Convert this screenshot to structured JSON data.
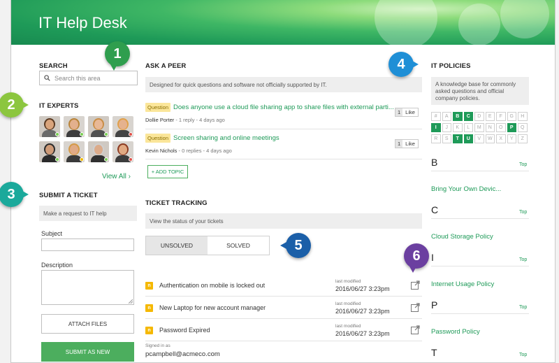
{
  "header": {
    "title": "IT Help Desk"
  },
  "search": {
    "heading": "SEARCH",
    "placeholder": "Search this area"
  },
  "experts": {
    "heading": "IT EXPERTS",
    "view_all": "View All ›",
    "people": [
      {
        "skin": "#d9a47c",
        "hair": "#5a3a22",
        "shirt": "#6a6a6a",
        "status": "#7ccf55"
      },
      {
        "skin": "#e3b08d",
        "hair": "#b8843a",
        "shirt": "#3d3d3d",
        "status": "#7ccf55"
      },
      {
        "skin": "#e8b896",
        "hair": "#c98d45",
        "shirt": "#505050",
        "status": "#7ccf55"
      },
      {
        "skin": "#e5b28e",
        "hair": "#e0a04a",
        "shirt": "#444",
        "status": "#e0524a"
      },
      {
        "skin": "#cf9b78",
        "hair": "#2c2c2c",
        "shirt": "#2a2a2a",
        "status": "#7ccf55"
      },
      {
        "skin": "#e0aa86",
        "hair": "#d49a48",
        "shirt": "#3a3a3a",
        "status": "#f0b900"
      },
      {
        "skin": "#dcab8a",
        "hair": "#cfcfcf",
        "shirt": "#303030",
        "status": "#7ccf55"
      },
      {
        "skin": "#e1a982",
        "hair": "#8c3b22",
        "shirt": "#3c3c3c",
        "status": "#e0524a"
      }
    ]
  },
  "ticket_form": {
    "heading": "SUBMIT A TICKET",
    "hint": "Make a request to IT help",
    "subject_label": "Subject",
    "description_label": "Description",
    "attach_label": "ATTACH FILES",
    "submit_label": "SUBMIT AS NEW"
  },
  "peer": {
    "heading": "ASK A PEER",
    "hint": "Designed for quick questions and software not officially supported by IT.",
    "questions": [
      {
        "badge": "Question",
        "title": "Does anyone use a cloud file sharing app to share files with external parti...",
        "author": "Dollie Porter",
        "meta": " - 1 reply - 4 days ago",
        "likes": "1",
        "like_label": "Like"
      },
      {
        "badge": "Question",
        "title": "Screen sharing and online meetings",
        "author": "Kevin Nichols",
        "meta": " - 0 replies - 4 days ago",
        "likes": "1",
        "like_label": "Like"
      }
    ],
    "add_topic": "+ ADD TOPIC"
  },
  "tracking": {
    "heading": "TICKET TRACKING",
    "hint": "View the status of your tickets",
    "tabs": [
      {
        "label": "UNSOLVED",
        "active": true
      },
      {
        "label": "SOLVED",
        "active": false
      }
    ],
    "tickets": [
      {
        "icon": "n",
        "title": "Authentication on mobile is locked out",
        "modified_label": "last modified",
        "date": "2016/06/27   3:23pm"
      },
      {
        "icon": "n",
        "title": "New Laptop for new account manager",
        "modified_label": "last modified",
        "date": "2016/06/27   3:23pm"
      },
      {
        "icon": "n",
        "title": "Password Expired",
        "modified_label": "last modified",
        "date": "2016/06/27   3:23pm"
      }
    ],
    "signed_in_label": "Signed in as",
    "signed_in_email": "pcampbell@acmeco.com"
  },
  "policies": {
    "heading": "IT POLICIES",
    "hint": "A knowledge base for commonly asked questions and official company policies.",
    "letters": [
      {
        "c": "#",
        "on": false
      },
      {
        "c": "A",
        "on": false
      },
      {
        "c": "B",
        "on": true
      },
      {
        "c": "C",
        "on": true
      },
      {
        "c": "D",
        "on": false
      },
      {
        "c": "E",
        "on": false
      },
      {
        "c": "F",
        "on": false
      },
      {
        "c": "G",
        "on": false
      },
      {
        "c": "H",
        "on": false
      },
      {
        "c": "I",
        "on": true
      },
      {
        "c": "J",
        "on": false
      },
      {
        "c": "K",
        "on": false
      },
      {
        "c": "L",
        "on": false
      },
      {
        "c": "M",
        "on": false
      },
      {
        "c": "N",
        "on": false
      },
      {
        "c": "O",
        "on": false
      },
      {
        "c": "P",
        "on": true
      },
      {
        "c": "Q",
        "on": false
      },
      {
        "c": "R",
        "on": false
      },
      {
        "c": "S",
        "on": false
      },
      {
        "c": "T",
        "on": true
      },
      {
        "c": "U",
        "on": true
      },
      {
        "c": "V",
        "on": false
      },
      {
        "c": "W",
        "on": false
      },
      {
        "c": "X",
        "on": false
      },
      {
        "c": "Y",
        "on": false
      },
      {
        "c": "Z",
        "on": false
      }
    ],
    "groups": [
      {
        "letter": "B",
        "top": "Top",
        "item": "Bring Your Own Devic..."
      },
      {
        "letter": "C",
        "top": "Top",
        "item": "Cloud Storage Policy"
      },
      {
        "letter": "I",
        "top": "Top",
        "item": "Internet Usage Policy"
      },
      {
        "letter": "P",
        "top": "Top",
        "item": "Password Policy"
      },
      {
        "letter": "T",
        "top": "Top",
        "item": ""
      }
    ]
  },
  "callouts": [
    {
      "n": "1",
      "color": "#2f9e4e"
    },
    {
      "n": "2",
      "color": "#8cc63f"
    },
    {
      "n": "3",
      "color": "#1ba99b"
    },
    {
      "n": "4",
      "color": "#1f8fd6"
    },
    {
      "n": "5",
      "color": "#1b5fa8"
    },
    {
      "n": "6",
      "color": "#6b3fa0"
    }
  ]
}
